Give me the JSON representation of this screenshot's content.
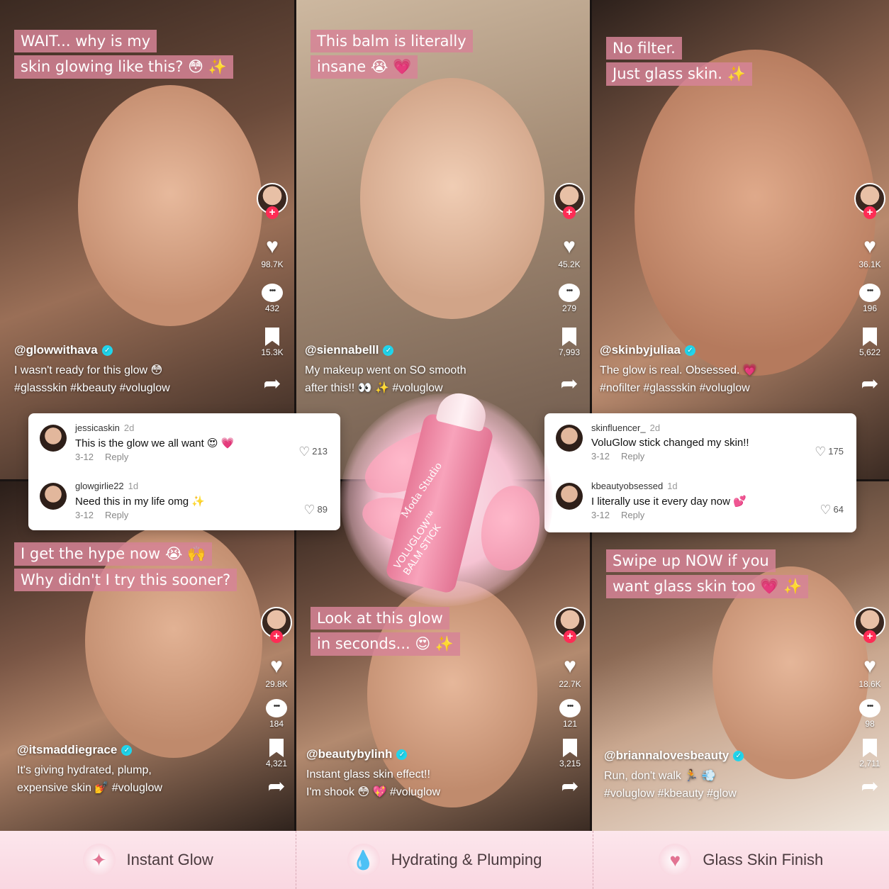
{
  "accent": "#fe2c55",
  "caption_bg": "#d68496",
  "tiles": [
    {
      "caption": [
        "WAIT... why is my",
        "skin glowing like this? 😳 ✨"
      ],
      "likes": "98.7K",
      "comments": "432",
      "saves": "15.3K",
      "handle": "@glowwithava",
      "desc": [
        "I wasn't ready for this glow 😳",
        "#glassskin #kbeauty #voluglow"
      ]
    },
    {
      "caption": [
        "This balm is literally",
        "insane 😭 💗"
      ],
      "likes": "45.2K",
      "comments": "279",
      "saves": "7,993",
      "handle": "@siennabelll",
      "desc": [
        "My makeup went on SO smooth",
        "after this!! 👀 ✨ #voluglow"
      ]
    },
    {
      "caption": [
        "No filter.",
        "Just glass skin. ✨"
      ],
      "likes": "36.1K",
      "comments": "196",
      "saves": "5,622",
      "handle": "@skinbyjuliaa",
      "desc": [
        "The glow is real. Obsessed. 💗",
        "#nofilter #glassskin #voluglow"
      ]
    },
    {
      "caption": [
        "I get the hype now 😭 🙌",
        "Why didn't I try this sooner?"
      ],
      "likes": "29.8K",
      "comments": "184",
      "saves": "4,321",
      "handle": "@itsmaddiegrace",
      "desc": [
        "It's giving hydrated, plump,",
        "expensive skin 💅 #voluglow"
      ]
    },
    {
      "caption": [
        "Look at this glow",
        "in seconds... 😍 ✨"
      ],
      "likes": "22.7K",
      "comments": "121",
      "saves": "3,215",
      "handle": "@beautybylinh",
      "desc": [
        "Instant glass skin effect!!",
        "I'm shook 😳 💖 #voluglow"
      ]
    },
    {
      "caption": [
        "Swipe up NOW if you",
        "want glass skin too 💗 ✨"
      ],
      "likes": "18.6K",
      "comments": "98",
      "saves": "2,711",
      "handle": "@briannalovesbeauty",
      "desc": [
        "Run, don't walk 🏃 💨",
        "#voluglow #kbeauty #glow"
      ]
    }
  ],
  "comment_boxes": [
    [
      {
        "user": "jessicaskin",
        "ago": "2d",
        "text": "This is the glow we all want 😍 💗",
        "date": "3-12",
        "reply": "Reply",
        "likes": "213"
      },
      {
        "user": "glowgirlie22",
        "ago": "1d",
        "text": "Need this in my life omg ✨",
        "date": "3-12",
        "reply": "Reply",
        "likes": "89"
      }
    ],
    [
      {
        "user": "skinfluencer_",
        "ago": "2d",
        "text": "VoluGlow stick changed my skin!!",
        "date": "3-12",
        "reply": "Reply",
        "likes": "175"
      },
      {
        "user": "kbeautyobsessed",
        "ago": "1d",
        "text": "I literally use it every day now 💕",
        "date": "3-12",
        "reply": "Reply",
        "likes": "64"
      }
    ]
  ],
  "product": {
    "brand": "Moda Studio",
    "name_line1": "VOLUGLOW™",
    "name_line2": "BALM STICK"
  },
  "features": [
    {
      "icon": "sparkles-icon",
      "glyph": "✦",
      "label": "Instant Glow"
    },
    {
      "icon": "droplet-icon",
      "glyph": "💧",
      "label": "Hydrating & Plumping"
    },
    {
      "icon": "heart-icon",
      "glyph": "♥",
      "label": "Glass Skin Finish"
    }
  ]
}
